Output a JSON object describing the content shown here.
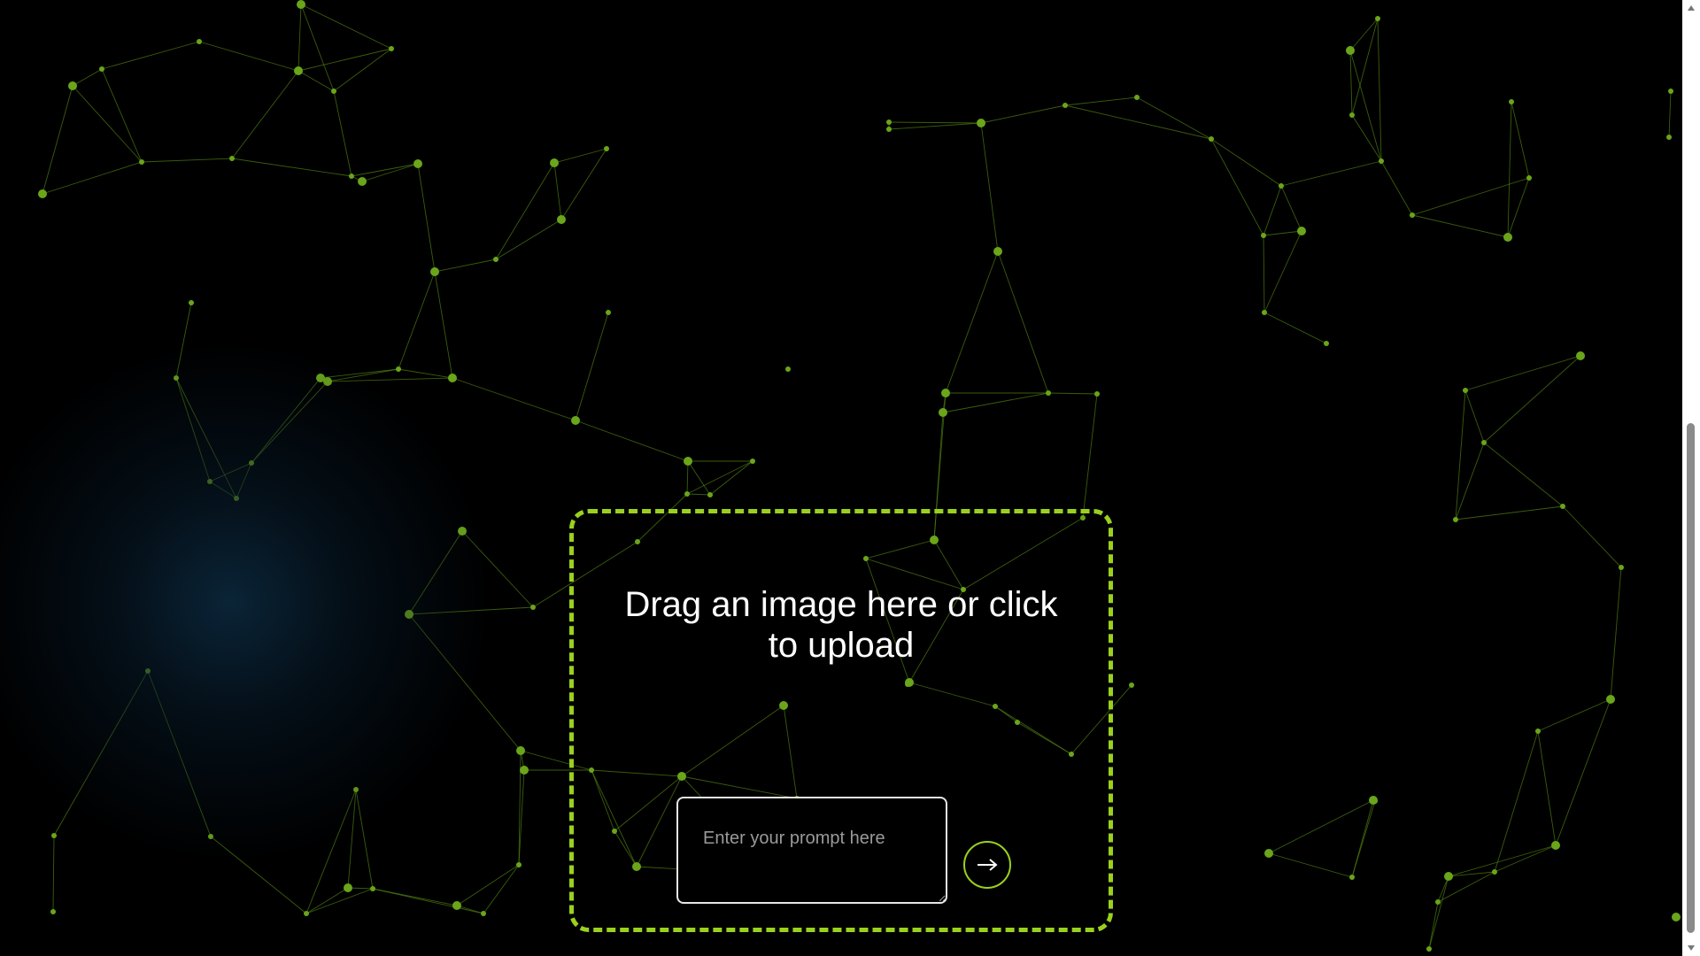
{
  "upload": {
    "instruction": "Drag an image here or click to upload"
  },
  "prompt": {
    "placeholder": "Enter your prompt here",
    "value": ""
  },
  "submit": {
    "icon": "arrow-right-icon"
  },
  "colors": {
    "accent": "#9ad11e",
    "node": "#6aa51a",
    "line": "#4f7c12",
    "background": "#000000",
    "glow": "#0c2a40"
  }
}
